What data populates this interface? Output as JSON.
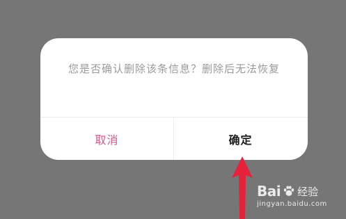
{
  "dialog": {
    "message": "您是否确认删除该条信息？删除后无法恢复",
    "cancel_label": "取消",
    "confirm_label": "确定"
  },
  "colors": {
    "cancel_accent": "#d45a87",
    "confirm_text": "#1d1d1d",
    "arrow_red": "#e8213a",
    "overlay": "#767676"
  },
  "watermark": {
    "brand": "Bai",
    "word": "经验",
    "url": "jingyan.baidu.com"
  },
  "icons": {
    "annotation_arrow": "arrow-up-icon",
    "watermark_logo": "paw-icon"
  }
}
